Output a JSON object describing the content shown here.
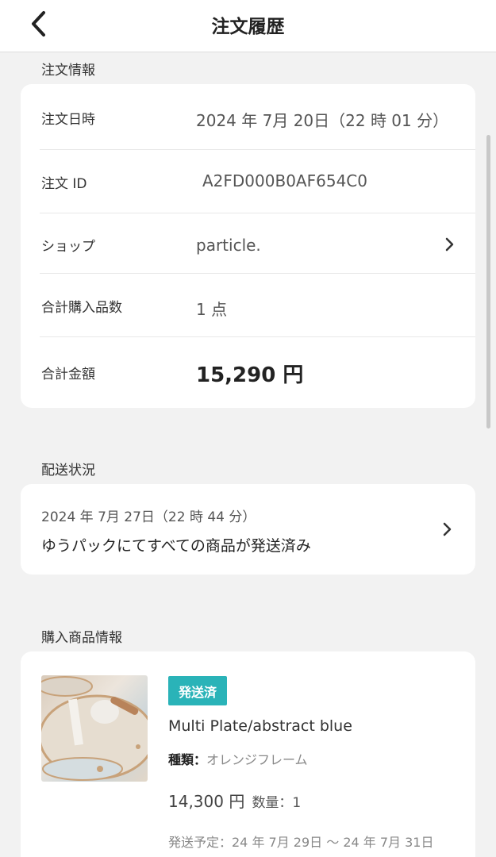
{
  "header": {
    "title": "注文履歴"
  },
  "order_info": {
    "section_label": "注文情報",
    "rows": {
      "date": {
        "label": "注文日時",
        "value": "2024 年 7月 20日（22 時 01 分）"
      },
      "id": {
        "label": "注文 ID",
        "value": "A2FD000B0AF654C0"
      },
      "shop": {
        "label": "ショップ",
        "value": "particle."
      },
      "quantity": {
        "label": "合計購入品数",
        "value": "1 点"
      },
      "total": {
        "label": "合計金額",
        "value": "15,290 円"
      }
    }
  },
  "shipping": {
    "section_label": "配送状況",
    "date": "2024 年 7月 27日（22 時 44 分）",
    "status": "ゆうパックにてすべての商品が発送済み"
  },
  "products": {
    "section_label": "購入商品情報",
    "items": [
      {
        "badge": "発送済",
        "name": "Multi Plate/abstract blue",
        "variant_label": "種類：",
        "variant_value": "オレンジフレーム",
        "price": "14,300 円",
        "quantity_label": "数量：1",
        "ship_schedule": "発送予定：24 年 7月 29日 〜 24 年 7月 31日"
      }
    ]
  },
  "colors": {
    "badge_bg": "#2ab3b8",
    "background": "#f2f2f2"
  }
}
